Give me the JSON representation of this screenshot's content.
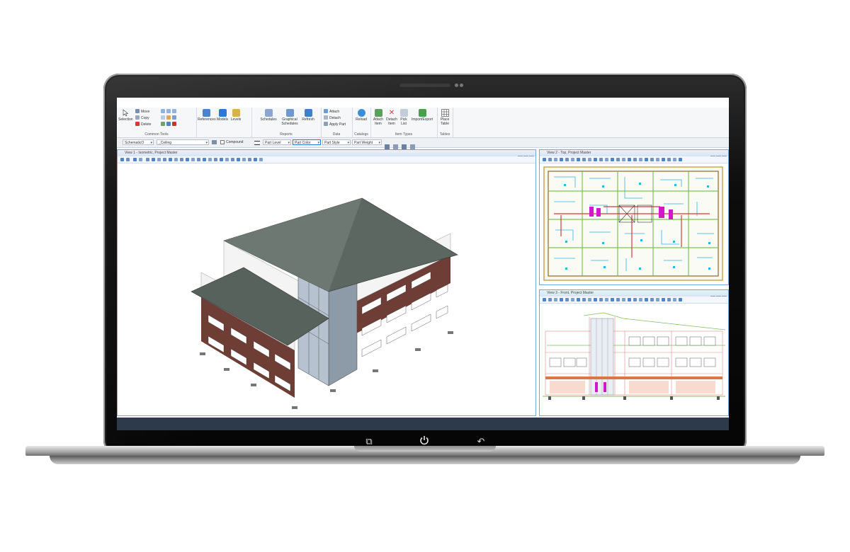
{
  "ribbon": {
    "groups": {
      "common": "Common Tools",
      "reports": "Reports",
      "data": "Data",
      "catalogs": "Catalogs",
      "item_types": "Item Types",
      "tables": "Tables"
    },
    "selection": "Selection",
    "move": "Move",
    "copy": "Copy",
    "delete": "Delete",
    "references": "References",
    "models": "Models",
    "levels": "Levels",
    "schedules": "Schedules",
    "graphical_schedules": "Graphical Schedules",
    "refresh": "Refresh",
    "attach": "Attach",
    "detach": "Detach",
    "apply_part": "Apply Part",
    "reload": "Reload",
    "attach_item": "Attach Item",
    "detach_item": "Detach Item",
    "pick_list": "Pick List",
    "import_export": "Import/Export",
    "place_table": "Place Table"
  },
  "propbar": {
    "level": "SchematicO",
    "model": "_Ceiling",
    "compound": "Compound",
    "part_level": "Part Level",
    "part_color": "Part Color",
    "part_style": "Part Style",
    "part_weight": "Part Weight"
  },
  "views": {
    "v1": "View 1 - Isometric, Project Master",
    "v2": "View 2 - Top, Project Master",
    "v3": "View 3 - Front, Project Master"
  },
  "colors": {
    "accent": "#2b79d3",
    "roof": "#5b6760",
    "brick": "#6e3d35",
    "status": "#2d3a4c"
  },
  "icons": [
    "selection-icon",
    "move-icon",
    "copy-icon",
    "delete-icon",
    "references-icon",
    "models-icon",
    "levels-icon",
    "schedules-icon",
    "refresh-icon",
    "reload-icon",
    "attach-item-icon",
    "detach-item-icon",
    "pick-list-icon",
    "import-export-icon",
    "place-table-icon",
    "power-icon",
    "back-icon",
    "overview-icon"
  ]
}
